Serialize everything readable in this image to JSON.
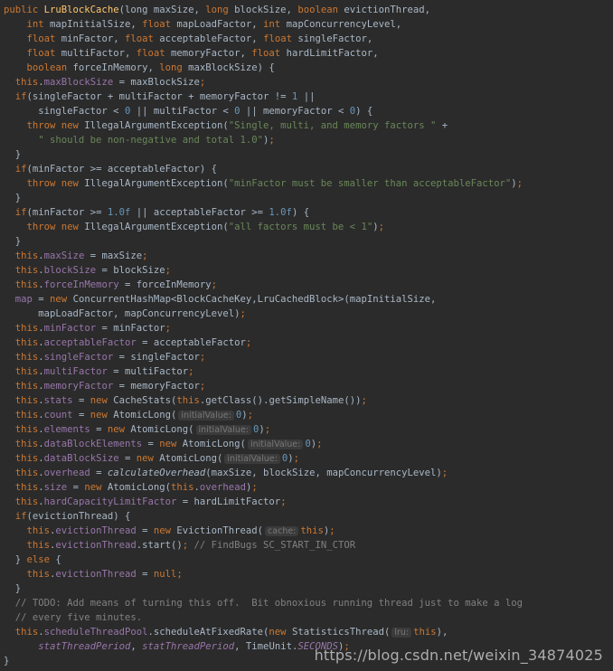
{
  "editor": {
    "language": "Java",
    "theme_colors": {
      "background": "#2b2b2b",
      "plain": "#a9b7c6",
      "keyword": "#cc7832",
      "field": "#9876aa",
      "string": "#6a8759",
      "number": "#6897bb",
      "comment": "#808080",
      "method_declaration": "#ffc66d",
      "param_hint_bg": "#3b3b3b"
    },
    "lines": [
      [
        [
          "kw",
          "public "
        ],
        [
          "cls",
          "LruBlockCache"
        ],
        [
          "p",
          "(long maxSize, "
        ],
        [
          "kw",
          "long "
        ],
        [
          "p",
          "blockSize, "
        ],
        [
          "kw",
          "boolean "
        ],
        [
          "p",
          "evictionThread,"
        ]
      ],
      [
        [
          "p",
          "    "
        ],
        [
          "kw",
          "int "
        ],
        [
          "p",
          "mapInitialSize, "
        ],
        [
          "kw",
          "float "
        ],
        [
          "p",
          "mapLoadFactor, "
        ],
        [
          "kw",
          "int "
        ],
        [
          "p",
          "mapConcurrencyLevel,"
        ]
      ],
      [
        [
          "p",
          "    "
        ],
        [
          "kw",
          "float "
        ],
        [
          "p",
          "minFactor, "
        ],
        [
          "kw",
          "float "
        ],
        [
          "p",
          "acceptableFactor, "
        ],
        [
          "kw",
          "float "
        ],
        [
          "p",
          "singleFactor,"
        ]
      ],
      [
        [
          "p",
          "    "
        ],
        [
          "kw",
          "float "
        ],
        [
          "p",
          "multiFactor, "
        ],
        [
          "kw",
          "float "
        ],
        [
          "p",
          "memoryFactor, "
        ],
        [
          "kw",
          "float "
        ],
        [
          "p",
          "hardLimitFactor,"
        ]
      ],
      [
        [
          "p",
          "    "
        ],
        [
          "kw",
          "boolean "
        ],
        [
          "p",
          "forceInMemory, "
        ],
        [
          "kw",
          "long "
        ],
        [
          "p",
          "maxBlockSize) {"
        ]
      ],
      [
        [
          "p",
          "  "
        ],
        [
          "kw",
          "this"
        ],
        [
          "p",
          "."
        ],
        [
          "fld",
          "maxBlockSize"
        ],
        [
          "p",
          " = maxBlockSize"
        ],
        [
          "kw",
          ";"
        ]
      ],
      [
        [
          "p",
          "  "
        ],
        [
          "kw",
          "if"
        ],
        [
          "p",
          "(singleFactor + multiFactor + memoryFactor != "
        ],
        [
          "num",
          "1"
        ],
        [
          "p",
          " ||"
        ]
      ],
      [
        [
          "p",
          "      singleFactor < "
        ],
        [
          "num",
          "0"
        ],
        [
          "p",
          " || multiFactor < "
        ],
        [
          "num",
          "0"
        ],
        [
          "p",
          " || memoryFactor < "
        ],
        [
          "num",
          "0"
        ],
        [
          "p",
          ") {"
        ]
      ],
      [
        [
          "p",
          "    "
        ],
        [
          "kw",
          "throw new "
        ],
        [
          "p",
          "IllegalArgumentException("
        ],
        [
          "str",
          "\"Single, multi, and memory factors \""
        ],
        [
          "p",
          " +"
        ]
      ],
      [
        [
          "p",
          "      "
        ],
        [
          "str",
          "\" should be non-negative and total 1.0\""
        ],
        [
          "p",
          ")"
        ],
        [
          "kw",
          ";"
        ]
      ],
      [
        [
          "p",
          "  }"
        ]
      ],
      [
        [
          "p",
          "  "
        ],
        [
          "kw",
          "if"
        ],
        [
          "p",
          "(minFactor >= acceptableFactor) {"
        ]
      ],
      [
        [
          "p",
          "    "
        ],
        [
          "kw",
          "throw new "
        ],
        [
          "p",
          "IllegalArgumentException("
        ],
        [
          "str",
          "\"minFactor must be smaller than acceptableFactor\""
        ],
        [
          "p",
          ")"
        ],
        [
          "kw",
          ";"
        ]
      ],
      [
        [
          "p",
          "  }"
        ]
      ],
      [
        [
          "p",
          "  "
        ],
        [
          "kw",
          "if"
        ],
        [
          "p",
          "(minFactor >= "
        ],
        [
          "num",
          "1.0f"
        ],
        [
          "p",
          " || acceptableFactor >= "
        ],
        [
          "num",
          "1.0f"
        ],
        [
          "p",
          ") {"
        ]
      ],
      [
        [
          "p",
          "    "
        ],
        [
          "kw",
          "throw new "
        ],
        [
          "p",
          "IllegalArgumentException("
        ],
        [
          "str",
          "\"all factors must be < 1\""
        ],
        [
          "p",
          ")"
        ],
        [
          "kw",
          ";"
        ]
      ],
      [
        [
          "p",
          "  }"
        ]
      ],
      [
        [
          "p",
          "  "
        ],
        [
          "kw",
          "this"
        ],
        [
          "p",
          "."
        ],
        [
          "fld",
          "maxSize"
        ],
        [
          "p",
          " = maxSize"
        ],
        [
          "kw",
          ";"
        ]
      ],
      [
        [
          "p",
          "  "
        ],
        [
          "kw",
          "this"
        ],
        [
          "p",
          "."
        ],
        [
          "fld",
          "blockSize"
        ],
        [
          "p",
          " = blockSize"
        ],
        [
          "kw",
          ";"
        ]
      ],
      [
        [
          "p",
          "  "
        ],
        [
          "kw",
          "this"
        ],
        [
          "p",
          "."
        ],
        [
          "fld",
          "forceInMemory"
        ],
        [
          "p",
          " = forceInMemory"
        ],
        [
          "kw",
          ";"
        ]
      ],
      [
        [
          "p",
          "  "
        ],
        [
          "fld",
          "map"
        ],
        [
          "p",
          " = "
        ],
        [
          "kw",
          "new "
        ],
        [
          "p",
          "ConcurrentHashMap<BlockCacheKey,LruCachedBlock>(mapInitialSize,"
        ]
      ],
      [
        [
          "p",
          "      mapLoadFactor, mapConcurrencyLevel)"
        ],
        [
          "kw",
          ";"
        ]
      ],
      [
        [
          "p",
          "  "
        ],
        [
          "kw",
          "this"
        ],
        [
          "p",
          "."
        ],
        [
          "fld",
          "minFactor"
        ],
        [
          "p",
          " = minFactor"
        ],
        [
          "kw",
          ";"
        ]
      ],
      [
        [
          "p",
          "  "
        ],
        [
          "kw",
          "this"
        ],
        [
          "p",
          "."
        ],
        [
          "fld",
          "acceptableFactor"
        ],
        [
          "p",
          " = acceptableFactor"
        ],
        [
          "kw",
          ";"
        ]
      ],
      [
        [
          "p",
          "  "
        ],
        [
          "kw",
          "this"
        ],
        [
          "p",
          "."
        ],
        [
          "fld",
          "singleFactor"
        ],
        [
          "p",
          " = singleFactor"
        ],
        [
          "kw",
          ";"
        ]
      ],
      [
        [
          "p",
          "  "
        ],
        [
          "kw",
          "this"
        ],
        [
          "p",
          "."
        ],
        [
          "fld",
          "multiFactor"
        ],
        [
          "p",
          " = multiFactor"
        ],
        [
          "kw",
          ";"
        ]
      ],
      [
        [
          "p",
          "  "
        ],
        [
          "kw",
          "this"
        ],
        [
          "p",
          "."
        ],
        [
          "fld",
          "memoryFactor"
        ],
        [
          "p",
          " = memoryFactor"
        ],
        [
          "kw",
          ";"
        ]
      ],
      [
        [
          "p",
          "  "
        ],
        [
          "kw",
          "this"
        ],
        [
          "p",
          "."
        ],
        [
          "fld",
          "stats"
        ],
        [
          "p",
          " = "
        ],
        [
          "kw",
          "new "
        ],
        [
          "p",
          "CacheStats("
        ],
        [
          "kw",
          "this"
        ],
        [
          "p",
          ".getClass().getSimpleName())"
        ],
        [
          "kw",
          ";"
        ]
      ],
      [
        [
          "p",
          "  "
        ],
        [
          "kw",
          "this"
        ],
        [
          "p",
          "."
        ],
        [
          "fld",
          "count"
        ],
        [
          "p",
          " = "
        ],
        [
          "kw",
          "new "
        ],
        [
          "p",
          "AtomicLong("
        ],
        [
          "hint",
          "initialValue:"
        ],
        [
          "num",
          "0"
        ],
        [
          "p",
          ")"
        ],
        [
          "kw",
          ";"
        ]
      ],
      [
        [
          "p",
          "  "
        ],
        [
          "kw",
          "this"
        ],
        [
          "p",
          "."
        ],
        [
          "fld",
          "elements"
        ],
        [
          "p",
          " = "
        ],
        [
          "kw",
          "new "
        ],
        [
          "p",
          "AtomicLong("
        ],
        [
          "hint",
          "initialValue:"
        ],
        [
          "num",
          "0"
        ],
        [
          "p",
          ")"
        ],
        [
          "kw",
          ";"
        ]
      ],
      [
        [
          "p",
          "  "
        ],
        [
          "kw",
          "this"
        ],
        [
          "p",
          "."
        ],
        [
          "fld",
          "dataBlockElements"
        ],
        [
          "p",
          " = "
        ],
        [
          "kw",
          "new "
        ],
        [
          "p",
          "AtomicLong("
        ],
        [
          "hint",
          "initialValue:"
        ],
        [
          "num",
          "0"
        ],
        [
          "p",
          ")"
        ],
        [
          "kw",
          ";"
        ]
      ],
      [
        [
          "p",
          "  "
        ],
        [
          "kw",
          "this"
        ],
        [
          "p",
          "."
        ],
        [
          "fld",
          "dataBlockSize"
        ],
        [
          "p",
          " = "
        ],
        [
          "kw",
          "new "
        ],
        [
          "p",
          "AtomicLong("
        ],
        [
          "hint",
          "initialValue:"
        ],
        [
          "num",
          "0"
        ],
        [
          "p",
          ")"
        ],
        [
          "kw",
          ";"
        ]
      ],
      [
        [
          "p",
          "  "
        ],
        [
          "kw",
          "this"
        ],
        [
          "p",
          "."
        ],
        [
          "fld",
          "overhead"
        ],
        [
          "p",
          " = "
        ],
        [
          "ital",
          "calculateOverhead"
        ],
        [
          "p",
          "(maxSize, blockSize, mapConcurrencyLevel)"
        ],
        [
          "kw",
          ";"
        ]
      ],
      [
        [
          "p",
          "  "
        ],
        [
          "kw",
          "this"
        ],
        [
          "p",
          "."
        ],
        [
          "fld",
          "size"
        ],
        [
          "p",
          " = "
        ],
        [
          "kw",
          "new "
        ],
        [
          "p",
          "AtomicLong("
        ],
        [
          "kw",
          "this"
        ],
        [
          "p",
          "."
        ],
        [
          "fld",
          "overhead"
        ],
        [
          "p",
          ")"
        ],
        [
          "kw",
          ";"
        ]
      ],
      [
        [
          "p",
          "  "
        ],
        [
          "kw",
          "this"
        ],
        [
          "p",
          "."
        ],
        [
          "fld",
          "hardCapacityLimitFactor"
        ],
        [
          "p",
          " = hardLimitFactor"
        ],
        [
          "kw",
          ";"
        ]
      ],
      [
        [
          "p",
          "  "
        ],
        [
          "kw",
          "if"
        ],
        [
          "p",
          "(evictionThread) {"
        ]
      ],
      [
        [
          "p",
          "    "
        ],
        [
          "kw",
          "this"
        ],
        [
          "p",
          "."
        ],
        [
          "fld",
          "evictionThread"
        ],
        [
          "p",
          " = "
        ],
        [
          "kw",
          "new "
        ],
        [
          "p",
          "EvictionThread("
        ],
        [
          "hint",
          "cache:"
        ],
        [
          "kw",
          "this"
        ],
        [
          "p",
          ")"
        ],
        [
          "kw",
          ";"
        ]
      ],
      [
        [
          "p",
          "    "
        ],
        [
          "kw",
          "this"
        ],
        [
          "p",
          "."
        ],
        [
          "fld",
          "evictionThread"
        ],
        [
          "p",
          ".start()"
        ],
        [
          "kw",
          ";"
        ],
        [
          "cmt",
          " // FindBugs SC_START_IN_CTOR"
        ]
      ],
      [
        [
          "p",
          "  } "
        ],
        [
          "kw",
          "else "
        ],
        [
          "p",
          "{"
        ]
      ],
      [
        [
          "p",
          "    "
        ],
        [
          "kw",
          "this"
        ],
        [
          "p",
          "."
        ],
        [
          "fld",
          "evictionThread"
        ],
        [
          "p",
          " = "
        ],
        [
          "kw",
          "null;"
        ]
      ],
      [
        [
          "p",
          "  }"
        ]
      ],
      [
        [
          "cmt",
          "  // TODO: Add means of turning this off.  Bit obnoxious running thread just to make a log"
        ]
      ],
      [
        [
          "cmt",
          "  // every five minutes."
        ]
      ],
      [
        [
          "p",
          "  "
        ],
        [
          "kw",
          "this"
        ],
        [
          "p",
          "."
        ],
        [
          "fld",
          "scheduleThreadPool"
        ],
        [
          "p",
          ".scheduleAtFixedRate("
        ],
        [
          "kw",
          "new "
        ],
        [
          "p",
          "StatisticsThread("
        ],
        [
          "hint",
          "lru:"
        ],
        [
          "kw",
          "this"
        ],
        [
          "p",
          "),"
        ]
      ],
      [
        [
          "p",
          "      "
        ],
        [
          "stat",
          "statThreadPeriod"
        ],
        [
          "p",
          ", "
        ],
        [
          "stat",
          "statThreadPeriod"
        ],
        [
          "p",
          ", TimeUnit."
        ],
        [
          "stat",
          "SECONDS"
        ],
        [
          "p",
          ")"
        ],
        [
          "kw",
          ";"
        ]
      ],
      [
        [
          "p",
          "}"
        ]
      ]
    ]
  },
  "watermark": "https://blog.csdn.net/weixin_34874025"
}
